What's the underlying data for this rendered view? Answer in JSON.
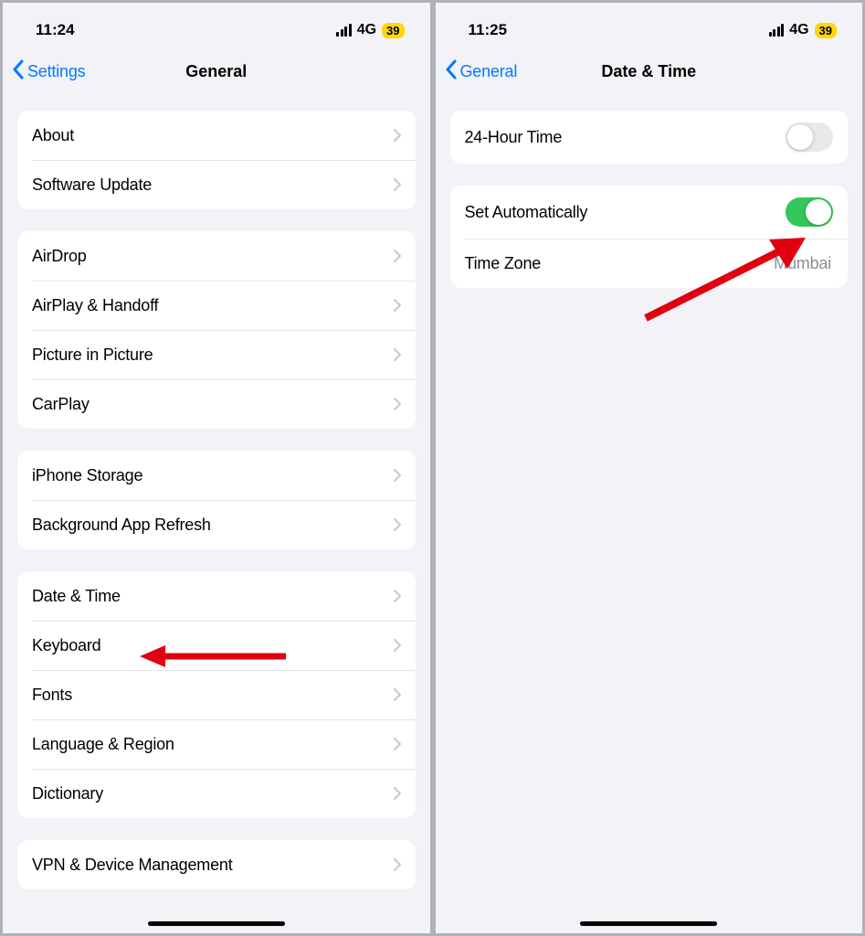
{
  "left": {
    "status": {
      "time": "11:24",
      "network": "4G",
      "battery": "39"
    },
    "nav": {
      "back": "Settings",
      "title": "General"
    },
    "groups": [
      [
        {
          "label": "About"
        },
        {
          "label": "Software Update"
        }
      ],
      [
        {
          "label": "AirDrop"
        },
        {
          "label": "AirPlay & Handoff"
        },
        {
          "label": "Picture in Picture"
        },
        {
          "label": "CarPlay"
        }
      ],
      [
        {
          "label": "iPhone Storage"
        },
        {
          "label": "Background App Refresh"
        }
      ],
      [
        {
          "label": "Date & Time"
        },
        {
          "label": "Keyboard"
        },
        {
          "label": "Fonts"
        },
        {
          "label": "Language & Region"
        },
        {
          "label": "Dictionary"
        }
      ],
      [
        {
          "label": "VPN & Device Management"
        }
      ]
    ]
  },
  "right": {
    "status": {
      "time": "11:25",
      "network": "4G",
      "battery": "39"
    },
    "nav": {
      "back": "General",
      "title": "Date & Time"
    },
    "rows": {
      "r24": {
        "label": "24-Hour Time",
        "on": false
      },
      "auto": {
        "label": "Set Automatically",
        "on": true
      },
      "tz": {
        "label": "Time Zone",
        "value": "Mumbai"
      }
    }
  }
}
